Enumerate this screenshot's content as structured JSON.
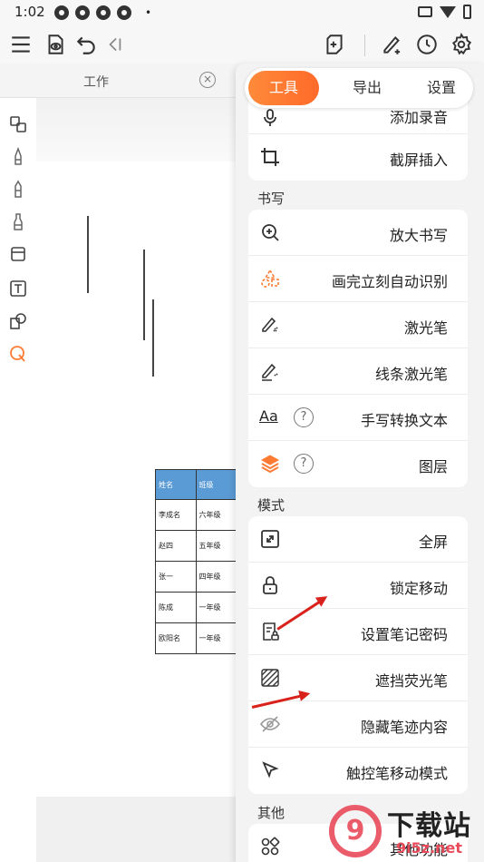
{
  "status_bar": {
    "time": "1:02",
    "dot": "•"
  },
  "tab": {
    "label": "工作",
    "close": "×"
  },
  "menu": {
    "tabs": [
      {
        "label": "工具",
        "active": true
      },
      {
        "label": "导出",
        "active": false
      },
      {
        "label": "设置",
        "active": false
      }
    ],
    "partial_item": "添加录音",
    "first_card": [
      {
        "icon": "crop-icon",
        "label": "截屏插入"
      }
    ],
    "writing": {
      "label": "书写",
      "items": [
        {
          "icon": "zoom-in-icon",
          "label": "放大书写"
        },
        {
          "icon": "shape-recognition-icon",
          "label": "画完立刻自动识别"
        },
        {
          "icon": "laser-pen-icon",
          "label": "激光笔"
        },
        {
          "icon": "line-laser-pen-icon",
          "label": "线条激光笔"
        },
        {
          "icon": "text-aa-icon",
          "label": "手写转换文本",
          "help": "?"
        },
        {
          "icon": "layers-icon",
          "label": "图层",
          "help": "?"
        }
      ]
    },
    "mode": {
      "label": "模式",
      "items": [
        {
          "icon": "fullscreen-icon",
          "label": "全屏"
        },
        {
          "icon": "lock-icon",
          "label": "锁定移动"
        },
        {
          "icon": "note-password-icon",
          "label": "设置笔记密码"
        },
        {
          "icon": "cover-highlighter-icon",
          "label": "遮挡荧光笔"
        },
        {
          "icon": "eye-hidden-icon",
          "label": "隐藏笔迹内容"
        },
        {
          "icon": "pointer-icon",
          "label": "触控笔移动模式"
        }
      ]
    },
    "other": {
      "label": "其他",
      "items": [
        {
          "icon": "apps-icon",
          "label": "其他功能"
        }
      ]
    }
  },
  "table": {
    "headers": [
      "姓名",
      "班级"
    ],
    "rows": [
      [
        "李成名",
        "六年级"
      ],
      [
        "赵四",
        "五年级"
      ],
      [
        "张一",
        "四年级"
      ],
      [
        "陈成",
        "一年级"
      ],
      [
        "欧阳名",
        "一年级"
      ]
    ]
  },
  "watermark": {
    "logo": "9",
    "title": "下载站",
    "url": "9i5z.net"
  },
  "colors": {
    "accent": "#ff7a32",
    "arrow": "#d9221c",
    "table_header": "#5b9bd5"
  }
}
